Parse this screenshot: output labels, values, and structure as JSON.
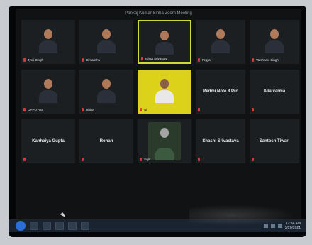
{
  "window": {
    "title": "Pankaj Kumar Sinha Zoom Meeting"
  },
  "participants": [
    {
      "name": "Jyoti Singh",
      "mode": "video"
    },
    {
      "name": "Himanshu",
      "mode": "video"
    },
    {
      "name": "Ishita Srivastav",
      "mode": "video",
      "active": true
    },
    {
      "name": "Prgya",
      "mode": "video"
    },
    {
      "name": "Vaishnavi Singh",
      "mode": "video"
    },
    {
      "name": "OPPO A5s",
      "mode": "video"
    },
    {
      "name": "Ishika",
      "mode": "video"
    },
    {
      "name": "Nil",
      "mode": "video_yellow"
    },
    {
      "name": "Redmi Note 8 Pro",
      "mode": "name"
    },
    {
      "name": "Alia varma",
      "mode": "name"
    },
    {
      "name": "Kanhaiya Gupta",
      "mode": "name"
    },
    {
      "name": "Rohan",
      "mode": "name"
    },
    {
      "name": "Sujit",
      "mode": "video"
    },
    {
      "name": "Shashi Srivastava",
      "mode": "name"
    },
    {
      "name": "Santosh Tiwari",
      "mode": "name"
    }
  ],
  "taskbar": {
    "time": "12:34 AM",
    "date": "5/20/2021"
  },
  "colors": {
    "active_border": "#cfd83a",
    "tile_bg": "#1c1f22",
    "screen_bg": "#101214",
    "mic_muted": "#d23b3b",
    "taskbar_bg": "#1a2330"
  },
  "icons": {
    "start": "windows-start-icon",
    "browser": "browser-icon",
    "explorer": "folder-icon",
    "media": "media-icon",
    "zoom": "zoom-icon"
  }
}
